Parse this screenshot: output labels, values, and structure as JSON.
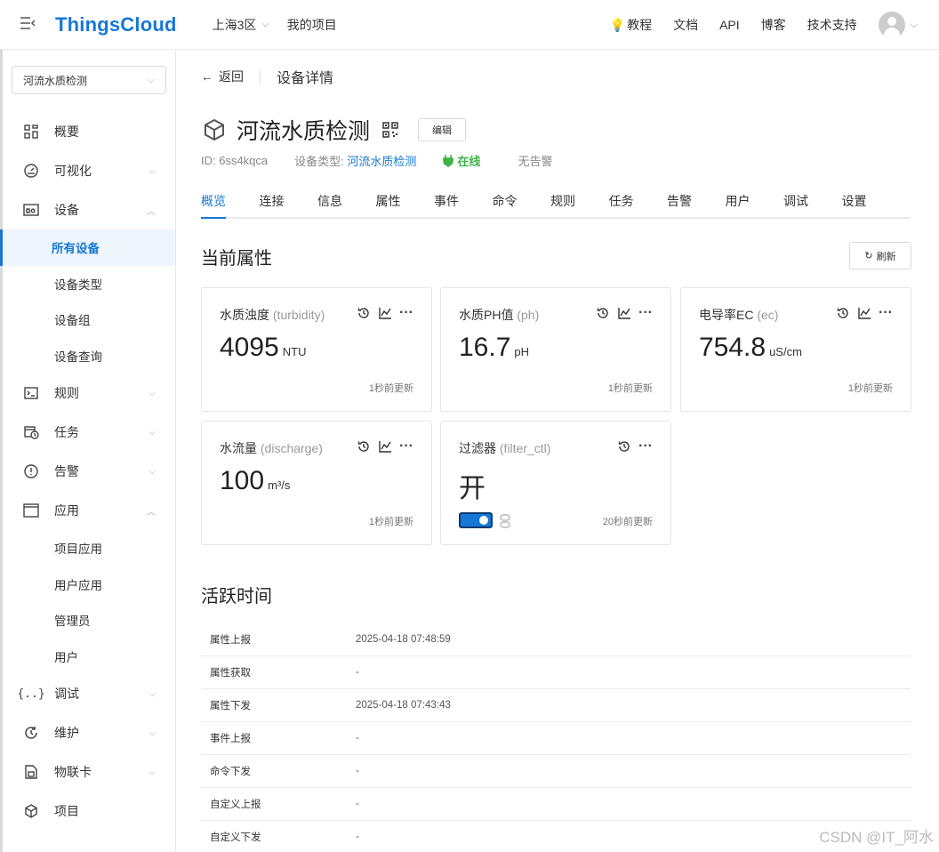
{
  "topbar": {
    "logo": "ThingsCloud",
    "region": "上海3区",
    "my_project": "我的项目",
    "links": [
      "教程",
      "文档",
      "API",
      "博客",
      "技术支持"
    ]
  },
  "sidebar": {
    "project_select": "河流水质检测",
    "items": [
      {
        "label": "概要"
      },
      {
        "label": "可视化"
      },
      {
        "label": "设备"
      },
      {
        "label": "所有设备"
      },
      {
        "label": "设备类型"
      },
      {
        "label": "设备组"
      },
      {
        "label": "设备查询"
      },
      {
        "label": "规则"
      },
      {
        "label": "任务"
      },
      {
        "label": "告警"
      },
      {
        "label": "应用"
      },
      {
        "label": "项目应用"
      },
      {
        "label": "用户应用"
      },
      {
        "label": "管理员"
      },
      {
        "label": "用户"
      },
      {
        "label": "调试"
      },
      {
        "label": "维护"
      },
      {
        "label": "物联卡"
      },
      {
        "label": "项目"
      }
    ]
  },
  "header": {
    "back": "返回",
    "page_title": "设备详情",
    "device_name": "河流水质检测",
    "edit": "编辑",
    "id_text": "ID: 6ss4kqca",
    "type_label": "设备类型:",
    "type_value": "河流水质检测",
    "online": "在线",
    "alarm": "无告警"
  },
  "tabs": [
    "概览",
    "连接",
    "信息",
    "属性",
    "事件",
    "命令",
    "规则",
    "任务",
    "告警",
    "用户",
    "调试",
    "设置"
  ],
  "props": {
    "title": "当前属性",
    "refresh": "刷新",
    "cards": [
      {
        "name": "水质浊度",
        "key": "(turbidity)",
        "value": "4095",
        "unit": "NTU",
        "updated": "1秒前更新"
      },
      {
        "name": "水质PH值",
        "key": "(ph)",
        "value": "16.7",
        "unit": "pH",
        "updated": "1秒前更新"
      },
      {
        "name": "电导率EC",
        "key": "(ec)",
        "value": "754.8",
        "unit": "uS/cm",
        "updated": "1秒前更新"
      },
      {
        "name": "水流量",
        "key": "(discharge)",
        "value": "100",
        "unit": "m³/s",
        "updated": "1秒前更新"
      },
      {
        "name": "过滤器",
        "key": "(filter_ctl)",
        "value": "开",
        "unit": "",
        "updated": "20秒前更新"
      }
    ]
  },
  "activity": {
    "title": "活跃时间",
    "rows": [
      {
        "label": "属性上报",
        "value": "2025-04-18 07:48:59"
      },
      {
        "label": "属性获取",
        "value": "-"
      },
      {
        "label": "属性下发",
        "value": "2025-04-18 07:43:43"
      },
      {
        "label": "事件上报",
        "value": "-"
      },
      {
        "label": "命令下发",
        "value": "-"
      },
      {
        "label": "自定义上报",
        "value": "-"
      },
      {
        "label": "自定义下发",
        "value": "-"
      }
    ]
  },
  "watermark": "CSDN @IT_阿水"
}
